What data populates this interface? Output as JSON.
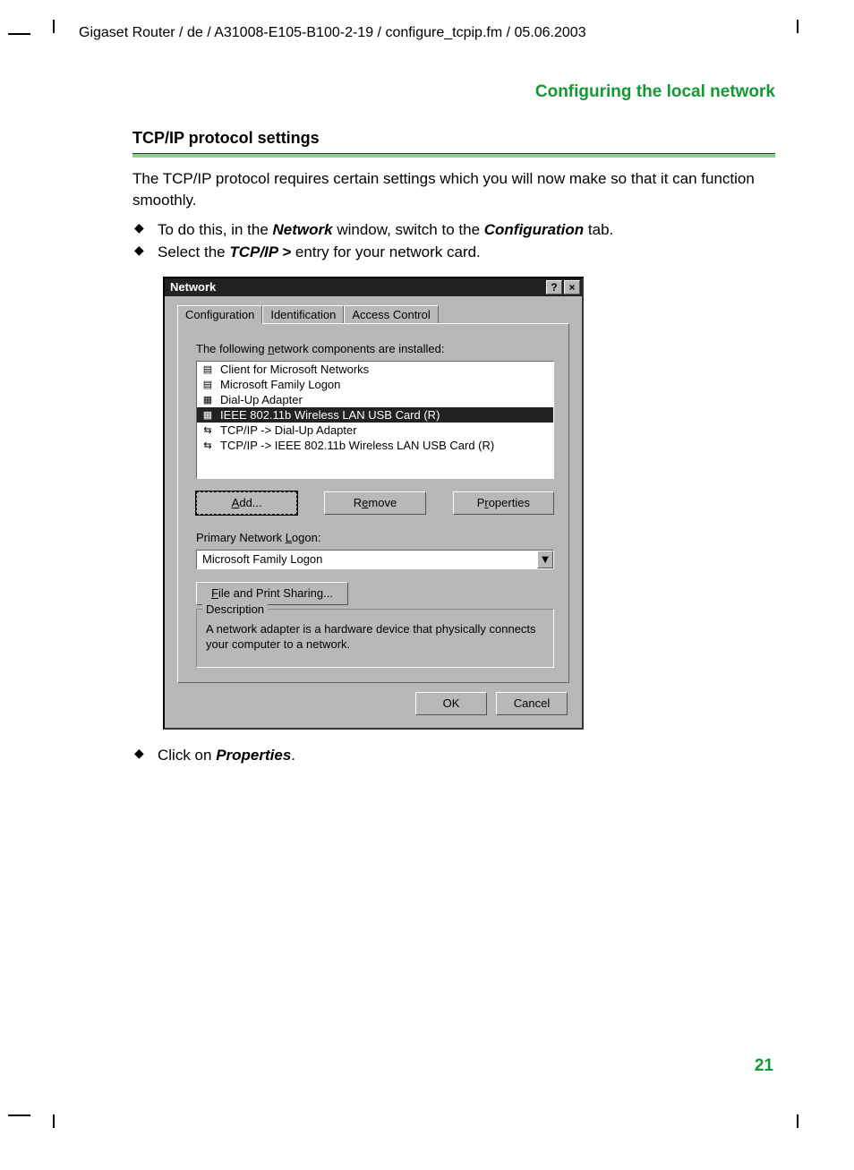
{
  "header_path": "Gigaset Router / de / A31008-E105-B100-2-19 / configure_tcpip.fm / 05.06.2003",
  "section_title": "Configuring the local network",
  "subsection_title": "TCP/IP protocol settings",
  "intro_text": "The TCP/IP protocol requires certain settings which you will now make so that it can function smoothly.",
  "bullets_pre": [
    {
      "prefix": "To do this, in the ",
      "bold1": "Network",
      "mid": " window, switch to the ",
      "bold2": "Configuration",
      "suffix": " tab."
    },
    {
      "prefix": "Select the ",
      "bold1": "TCP/IP >",
      "mid": " entry for your network card.",
      "bold2": "",
      "suffix": ""
    }
  ],
  "bullets_post": [
    {
      "prefix": "Click on ",
      "bold1": "Properties",
      "mid": ".",
      "bold2": "",
      "suffix": ""
    }
  ],
  "dialog": {
    "title": "Network",
    "help": "?",
    "close": "×",
    "tabs": [
      "Configuration",
      "Identification",
      "Access Control"
    ],
    "components_label_pre": "The following ",
    "components_label_u": "n",
    "components_label_post": "etwork components are installed:",
    "items": [
      "Client for Microsoft Networks",
      "Microsoft Family Logon",
      "Dial-Up Adapter",
      "IEEE 802.11b Wireless LAN USB Card (R)",
      "TCP/IP -> Dial-Up Adapter",
      "TCP/IP -> IEEE 802.11b Wireless LAN USB Card (R)"
    ],
    "selected_index": 3,
    "add": "Add...",
    "remove": "Remove",
    "properties": "Properties",
    "primary_label_pre": "Primary Network ",
    "primary_label_u": "L",
    "primary_label_post": "ogon:",
    "primary_value": "Microsoft Family Logon",
    "file_print": "File and Print Sharing...",
    "desc_legend": "Description",
    "desc_text": "A network adapter is a hardware device that physically connects your computer to a network.",
    "ok": "OK",
    "cancel": "Cancel"
  },
  "page_number": "21"
}
